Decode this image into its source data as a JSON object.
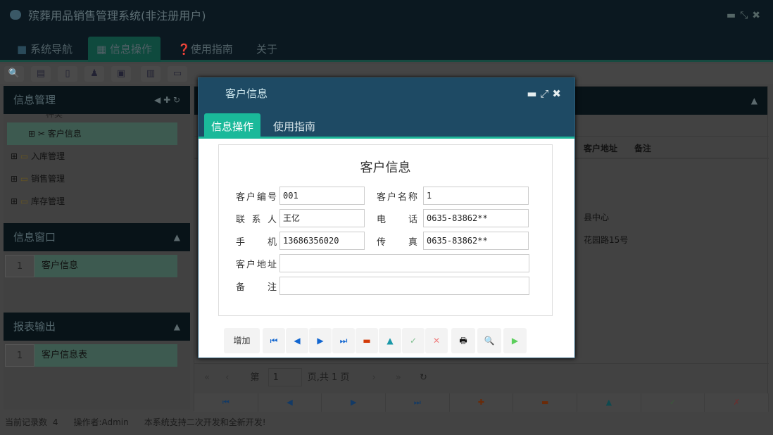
{
  "app": {
    "title": "殡葬用品销售管理系统(非注册用户)",
    "window_controls": [
      "minimize",
      "restore",
      "close"
    ]
  },
  "nav": {
    "tabs": [
      {
        "label": "系统导航"
      },
      {
        "label": "信息操作"
      },
      {
        "label": "使用指南"
      },
      {
        "label": "关于"
      }
    ]
  },
  "left": {
    "panel1": {
      "title": "信息管理",
      "tree": [
        {
          "label": "种类"
        },
        {
          "label": "客户信息"
        },
        {
          "label": "入库管理"
        },
        {
          "label": "销售管理"
        },
        {
          "label": "库存管理"
        }
      ]
    },
    "panel2": {
      "title": "信息窗口",
      "items": [
        {
          "num": "1",
          "label": "客户信息"
        }
      ]
    },
    "panel3": {
      "title": "报表输出",
      "items": [
        {
          "num": "1",
          "label": "客户信息表"
        }
      ]
    }
  },
  "grid": {
    "columns": [
      "客户地址",
      "备注"
    ],
    "rows": [
      [
        "",
        ""
      ],
      [
        "",
        ""
      ],
      [
        "县中心",
        ""
      ],
      [
        "花园路15号",
        ""
      ],
      [
        "",
        ""
      ]
    ],
    "pager": {
      "page_prefix": "第",
      "page": "1",
      "page_suffix": "页,共 1 页"
    }
  },
  "status": {
    "records": "当前记录数 4",
    "operator": "操作者:Admin",
    "note": "本系统支持二次开发和全新开发!"
  },
  "dialog": {
    "title": "客户信息",
    "tabs": [
      {
        "label": "信息操作"
      },
      {
        "label": "使用指南"
      }
    ],
    "form_title": "客户信息",
    "fields": {
      "code": {
        "label": "客户编号",
        "value": "001"
      },
      "name": {
        "label": "客户名称",
        "value": "1"
      },
      "contact": {
        "label": "联系人",
        "value": "王亿"
      },
      "phone": {
        "label": "电话",
        "value": "0635-83862**"
      },
      "mobile": {
        "label": "手机",
        "value": "13686356020"
      },
      "fax": {
        "label": "传真",
        "value": "0635-83862**"
      },
      "address": {
        "label": "客户地址",
        "value": ""
      },
      "remark": {
        "label": "备注",
        "value": ""
      }
    },
    "add_label": "增加"
  }
}
